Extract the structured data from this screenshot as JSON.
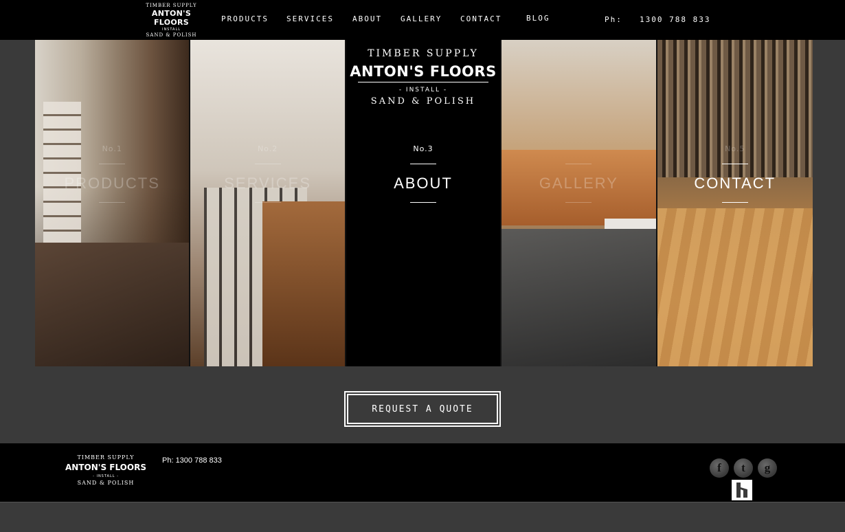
{
  "header": {
    "logo": {
      "top": "TIMBER SUPPLY",
      "main": "ANTON'S FLOORS",
      "mid": "INSTALL",
      "bottom": "SAND & POLISH"
    },
    "nav": [
      {
        "label": "PRODUCTS"
      },
      {
        "label": "SERVICES"
      },
      {
        "label": "ABOUT"
      },
      {
        "label": "GALLERY"
      },
      {
        "label": "CONTACT"
      },
      {
        "label": "BLOG"
      }
    ],
    "phone_label": "Ph:",
    "phone_number": "1300 788 833"
  },
  "panels": [
    {
      "number": "No.1",
      "title": "PRODUCTS"
    },
    {
      "number": "No.2",
      "title": "SERVICES"
    },
    {
      "number": "No.3",
      "title": "ABOUT",
      "logo": {
        "top": "TIMBER SUPPLY",
        "main": "ANTON'S FLOORS",
        "mid": "- INSTALL -",
        "bottom": "SAND & POLISH"
      }
    },
    {
      "number": "",
      "title": "GALLERY"
    },
    {
      "number": "No.5",
      "title": "CONTACT"
    }
  ],
  "cta": {
    "label": "REQUEST A QUOTE"
  },
  "footer": {
    "logo": {
      "top": "TIMBER SUPPLY",
      "main": "ANTON'S FLOORS",
      "mid": "- INSTALL -",
      "bottom": "SAND & POLISH"
    },
    "phone": "Ph: 1300 788 833",
    "social": [
      {
        "icon": "facebook-icon",
        "glyph": "f"
      },
      {
        "icon": "twitter-icon",
        "glyph": "t"
      },
      {
        "icon": "google-icon",
        "glyph": "g"
      }
    ],
    "houzz_icon": "houzz-icon"
  }
}
